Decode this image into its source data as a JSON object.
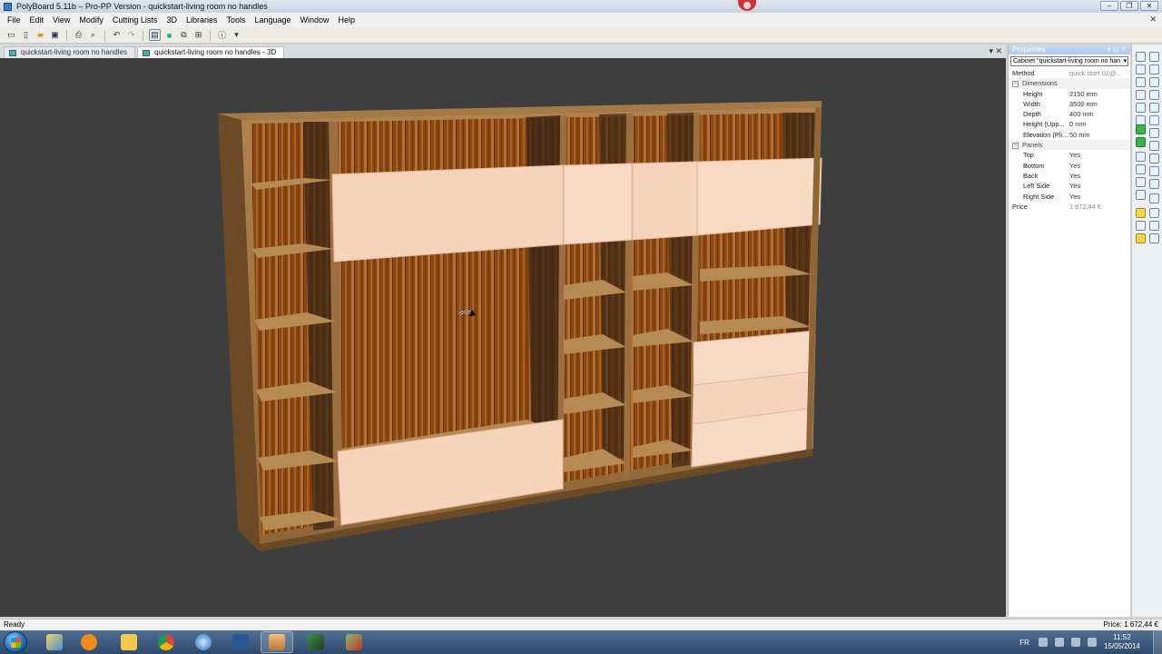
{
  "window": {
    "title": "PolyBoard 5.11b – Pro-PP Version - quickstart-living room no handles",
    "controls": [
      "‒",
      "❐",
      "✕"
    ]
  },
  "menu": {
    "items": [
      "File",
      "Edit",
      "View",
      "Modify",
      "Cutting Lists",
      "3D",
      "Libraries",
      "Tools",
      "Language",
      "Window",
      "Help"
    ],
    "close": "✕"
  },
  "tabs": {
    "items": [
      {
        "label": "quickstart-living room no handles",
        "active": false
      },
      {
        "label": "quickstart-living room no handles - 3D",
        "active": true
      }
    ],
    "controls": "▾  ✕"
  },
  "properties": {
    "header": "Properties",
    "header_controls": "▾ ⊡ ✕",
    "selector": "Cabinet \"quickstart-living room no han",
    "method": {
      "key": "Method",
      "value": "quick start 02@..."
    },
    "dimensions_label": "Dimensions",
    "dimensions": [
      {
        "key": "Height",
        "value": "2150 mm"
      },
      {
        "key": "Width",
        "value": "3500 mm"
      },
      {
        "key": "Depth",
        "value": "400 mm"
      },
      {
        "key": "Height (Upp...",
        "value": "0 mm"
      },
      {
        "key": "Elevation (Pli...",
        "value": "50 mm"
      }
    ],
    "panels_label": "Panels",
    "panels": [
      {
        "key": "Top",
        "value": "Yes"
      },
      {
        "key": "Bottom",
        "value": "Yes"
      },
      {
        "key": "Back",
        "value": "Yes"
      },
      {
        "key": "Left Side",
        "value": "Yes"
      },
      {
        "key": "Right Side",
        "value": "Yes"
      }
    ],
    "price": {
      "key": "Price",
      "value": "1 672,44 €"
    }
  },
  "status": {
    "left": "Ready",
    "right": "Price: 1 672,44 €"
  },
  "tray": {
    "language": "FR",
    "time": "11:52",
    "date": "15/05/2014"
  },
  "colors": {
    "viewport_bg": "#3e3e3e",
    "wood_frame": "#9b6f3f",
    "back_panel": "#8a4a16",
    "door_face": "#f6d3bb",
    "selection": "#3bb44a"
  }
}
